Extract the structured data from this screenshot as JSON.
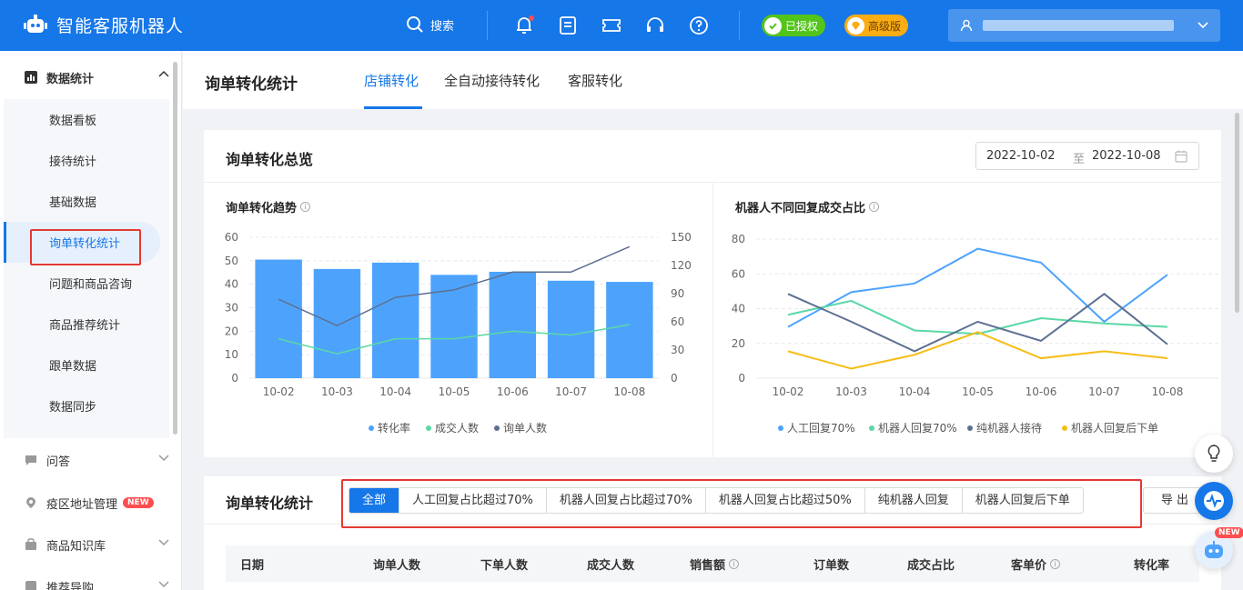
{
  "app": {
    "title": "智能客服机器人"
  },
  "topbar": {
    "search_label": "搜索",
    "authorized_label": "已授权",
    "edition_label": "高级版",
    "icons": [
      "bell-icon",
      "checklist-icon",
      "ticket-icon",
      "headset-icon",
      "help-icon"
    ]
  },
  "sidebar": {
    "groups": [
      {
        "label": "数据统计",
        "icon": "bar-chart-icon"
      },
      {
        "label": "问答",
        "icon": "chat-icon"
      },
      {
        "label": "疫区地址管理",
        "icon": "location-icon",
        "badge": "NEW"
      },
      {
        "label": "商品知识库",
        "icon": "bag-icon"
      },
      {
        "label": "推荐导购",
        "icon": "guide-icon"
      }
    ],
    "items": [
      {
        "label": "数据看板"
      },
      {
        "label": "接待统计"
      },
      {
        "label": "基础数据"
      },
      {
        "label": "询单转化统计"
      },
      {
        "label": "问题和商品咨询"
      },
      {
        "label": "商品推荐统计"
      },
      {
        "label": "跟单数据"
      },
      {
        "label": "数据同步"
      }
    ]
  },
  "header": {
    "title": "询单转化统计",
    "tabs": [
      {
        "label": "店铺转化"
      },
      {
        "label": "全自动接待转化"
      },
      {
        "label": "客服转化"
      }
    ]
  },
  "overview": {
    "title": "询单转化总览",
    "date_from": "2022-10-02",
    "date_sep": "至",
    "date_to": "2022-10-08"
  },
  "chart_data": [
    {
      "type": "bar",
      "title": "询单转化趋势",
      "categories": [
        "10-02",
        "10-03",
        "10-04",
        "10-05",
        "10-06",
        "10-07",
        "10-08"
      ],
      "ylim": [
        0,
        60
      ],
      "y_ticks": [
        "0",
        "10",
        "20",
        "30",
        "40",
        "50",
        "60"
      ],
      "y2lim": [
        0,
        150
      ],
      "y2_ticks": [
        "0",
        "30",
        "60",
        "90",
        "120",
        "150"
      ],
      "series": [
        {
          "name": "转化率",
          "kind": "bar",
          "axis": "left",
          "color": "#4da3fc",
          "values": [
            50.5,
            46.5,
            49.2,
            44,
            45.3,
            41.5,
            41
          ]
        },
        {
          "name": "成交人数",
          "kind": "line",
          "axis": "right",
          "color": "#5ad8a6",
          "values": [
            42,
            26,
            42,
            42,
            50,
            46,
            57
          ]
        },
        {
          "name": "询单人数",
          "kind": "line",
          "axis": "right",
          "color": "#5d7092",
          "values": [
            84,
            56,
            86,
            94,
            113,
            113,
            140
          ]
        }
      ],
      "legend_position": "bottom"
    },
    {
      "type": "line",
      "title": "机器人不同回复成交占比",
      "categories": [
        "10-02",
        "10-03",
        "10-04",
        "10-05",
        "10-06",
        "10-07",
        "10-08"
      ],
      "ylim": [
        0,
        80
      ],
      "y_ticks": [
        "0",
        "20",
        "40",
        "60",
        "80"
      ],
      "series": [
        {
          "name": "人工回复70%",
          "color": "#4da3fc",
          "values": [
            30,
            50,
            55,
            75,
            67,
            33,
            60
          ]
        },
        {
          "name": "机器人回复70%",
          "color": "#5ad8a6",
          "values": [
            37,
            45,
            28,
            26,
            35,
            32,
            30
          ]
        },
        {
          "name": "纯机器人接待",
          "color": "#5d7092",
          "values": [
            49,
            33,
            16,
            33,
            22,
            49,
            20
          ]
        },
        {
          "name": "机器人回复后下单",
          "color": "#f6bd16",
          "values": [
            16,
            6,
            14,
            27,
            12,
            16,
            12
          ]
        }
      ],
      "legend_position": "bottom"
    }
  ],
  "stats": {
    "title": "询单转化统计",
    "filters": [
      {
        "label": "全部"
      },
      {
        "label": "人工回复占比超过70%"
      },
      {
        "label": "机器人回复占比超过70%"
      },
      {
        "label": "机器人回复占比超过50%"
      },
      {
        "label": "纯机器人回复"
      },
      {
        "label": "机器人回复后下单"
      }
    ],
    "export_label": "导 出",
    "columns": [
      "日期",
      "询单人数",
      "下单人数",
      "成交人数",
      "销售额",
      "订单数",
      "成交占比",
      "客单价",
      "转化率"
    ]
  },
  "floating": {
    "new_badge": "NEW"
  },
  "colors": {
    "primary": "#1677e8",
    "highlight_box": "#e53935"
  }
}
